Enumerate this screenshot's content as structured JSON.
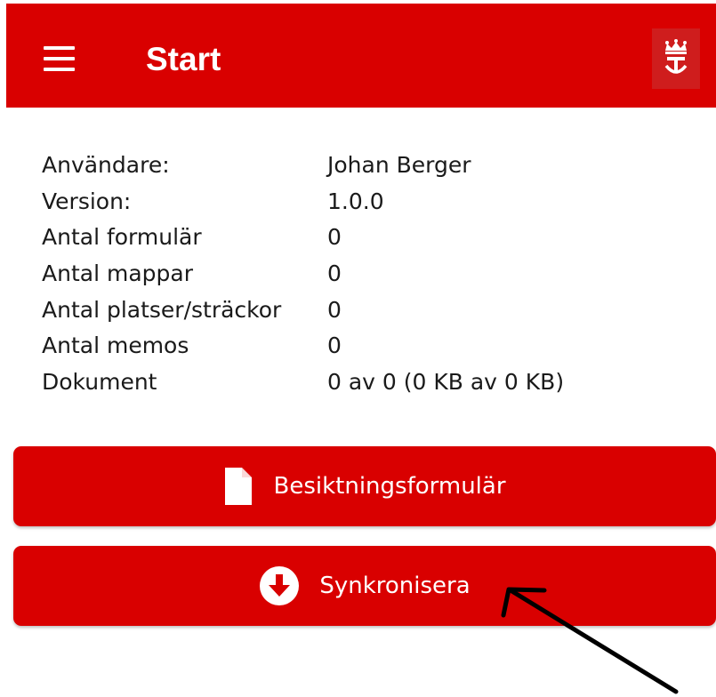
{
  "app_bar": {
    "title": "Start",
    "menu_icon": "hamburger-menu-icon",
    "logo_icon": "crown-emblem-icon"
  },
  "info": {
    "rows": [
      {
        "label": "Användare:",
        "value": "Johan Berger"
      },
      {
        "label": "Version:",
        "value": "1.0.0"
      },
      {
        "label": "Antal formulär",
        "value": "0"
      },
      {
        "label": "Antal mappar",
        "value": "0"
      },
      {
        "label": "Antal platser/sträckor",
        "value": "0"
      },
      {
        "label": "Antal memos",
        "value": "0"
      },
      {
        "label": "Dokument",
        "value": "0 av 0 (0 KB av 0 KB)"
      }
    ]
  },
  "buttons": {
    "forms": {
      "label": "Besiktningsformulär",
      "icon": "document-icon"
    },
    "sync": {
      "label": "Synkronisera",
      "icon": "download-circle-icon"
    }
  },
  "annotation": {
    "icon": "pointer-arrow"
  },
  "colors": {
    "brand_red": "#d90000",
    "text": "#1a1a1a",
    "background": "#ffffff"
  }
}
